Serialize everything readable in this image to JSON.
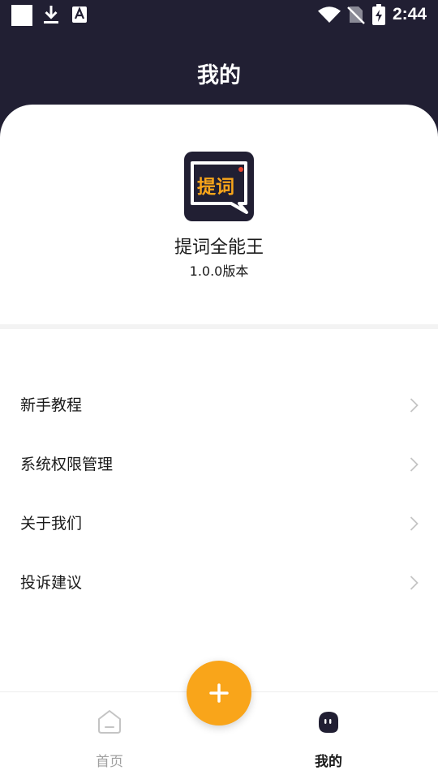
{
  "status_bar": {
    "time": "2:44",
    "icons": [
      "notification-square-icon",
      "download-icon",
      "a-icon",
      "wifi-icon",
      "no-sim-icon",
      "battery-charging-icon"
    ]
  },
  "header": {
    "title": "我的"
  },
  "app_info": {
    "logo_text": "提词",
    "name": "提词全能王",
    "version": "1.0.0版本"
  },
  "menu": {
    "items": [
      {
        "label": "新手教程",
        "icon": "chevron-right-icon"
      },
      {
        "label": "系统权限管理",
        "icon": "chevron-right-icon"
      },
      {
        "label": "关于我们",
        "icon": "chevron-right-icon"
      },
      {
        "label": "投诉建议",
        "icon": "chevron-right-icon"
      }
    ]
  },
  "tab_bar": {
    "tabs": [
      {
        "label": "首页",
        "icon": "home-icon",
        "active": false
      },
      {
        "label": "我的",
        "icon": "mine-icon",
        "active": true
      }
    ],
    "fab_icon": "plus-icon"
  },
  "colors": {
    "header_bg": "#211f33",
    "accent": "#f9a51a",
    "text": "#1a1a1a",
    "inactive": "#a0a0a0"
  }
}
